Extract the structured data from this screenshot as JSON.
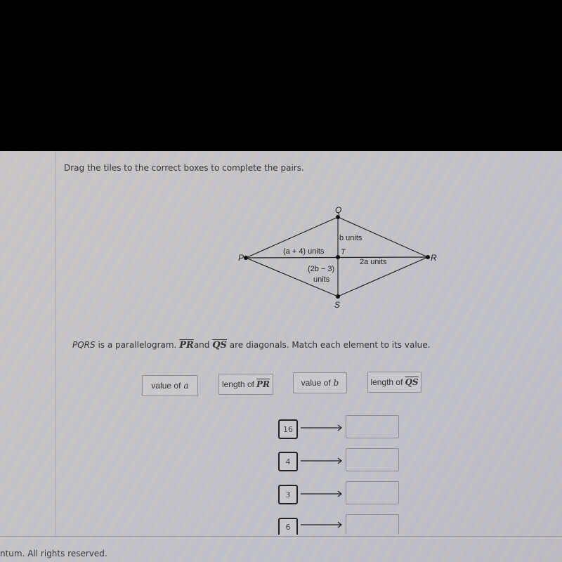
{
  "instructions": "Drag the tiles to the correct boxes to complete the pairs.",
  "diagram": {
    "points": {
      "P": "P",
      "Q": "Q",
      "R": "R",
      "S": "S",
      "T": "T"
    },
    "labels": {
      "PT": "(a + 4) units",
      "QT": "b units",
      "TR": "2a units",
      "TS_line1": "(2b − 3)",
      "TS_line2": "units"
    }
  },
  "problem": {
    "shape_name": "PQRS",
    "text_1": " is a parallelogram. ",
    "diag_1": "PR",
    "text_2": "and ",
    "diag_2": "QS",
    "text_3": " are diagonals. Match each element to its value."
  },
  "tiles": [
    {
      "prefix": "value of",
      "var": "a"
    },
    {
      "prefix": "length of",
      "seg": "PR"
    },
    {
      "prefix": "value of",
      "var": "b"
    },
    {
      "prefix": "length of",
      "seg": "QS"
    }
  ],
  "pairs": [
    {
      "value": "16",
      "drop": ""
    },
    {
      "value": "4",
      "drop": ""
    },
    {
      "value": "3",
      "drop": ""
    },
    {
      "value": "6",
      "drop": ""
    }
  ],
  "footer": "ntum. All rights reserved."
}
